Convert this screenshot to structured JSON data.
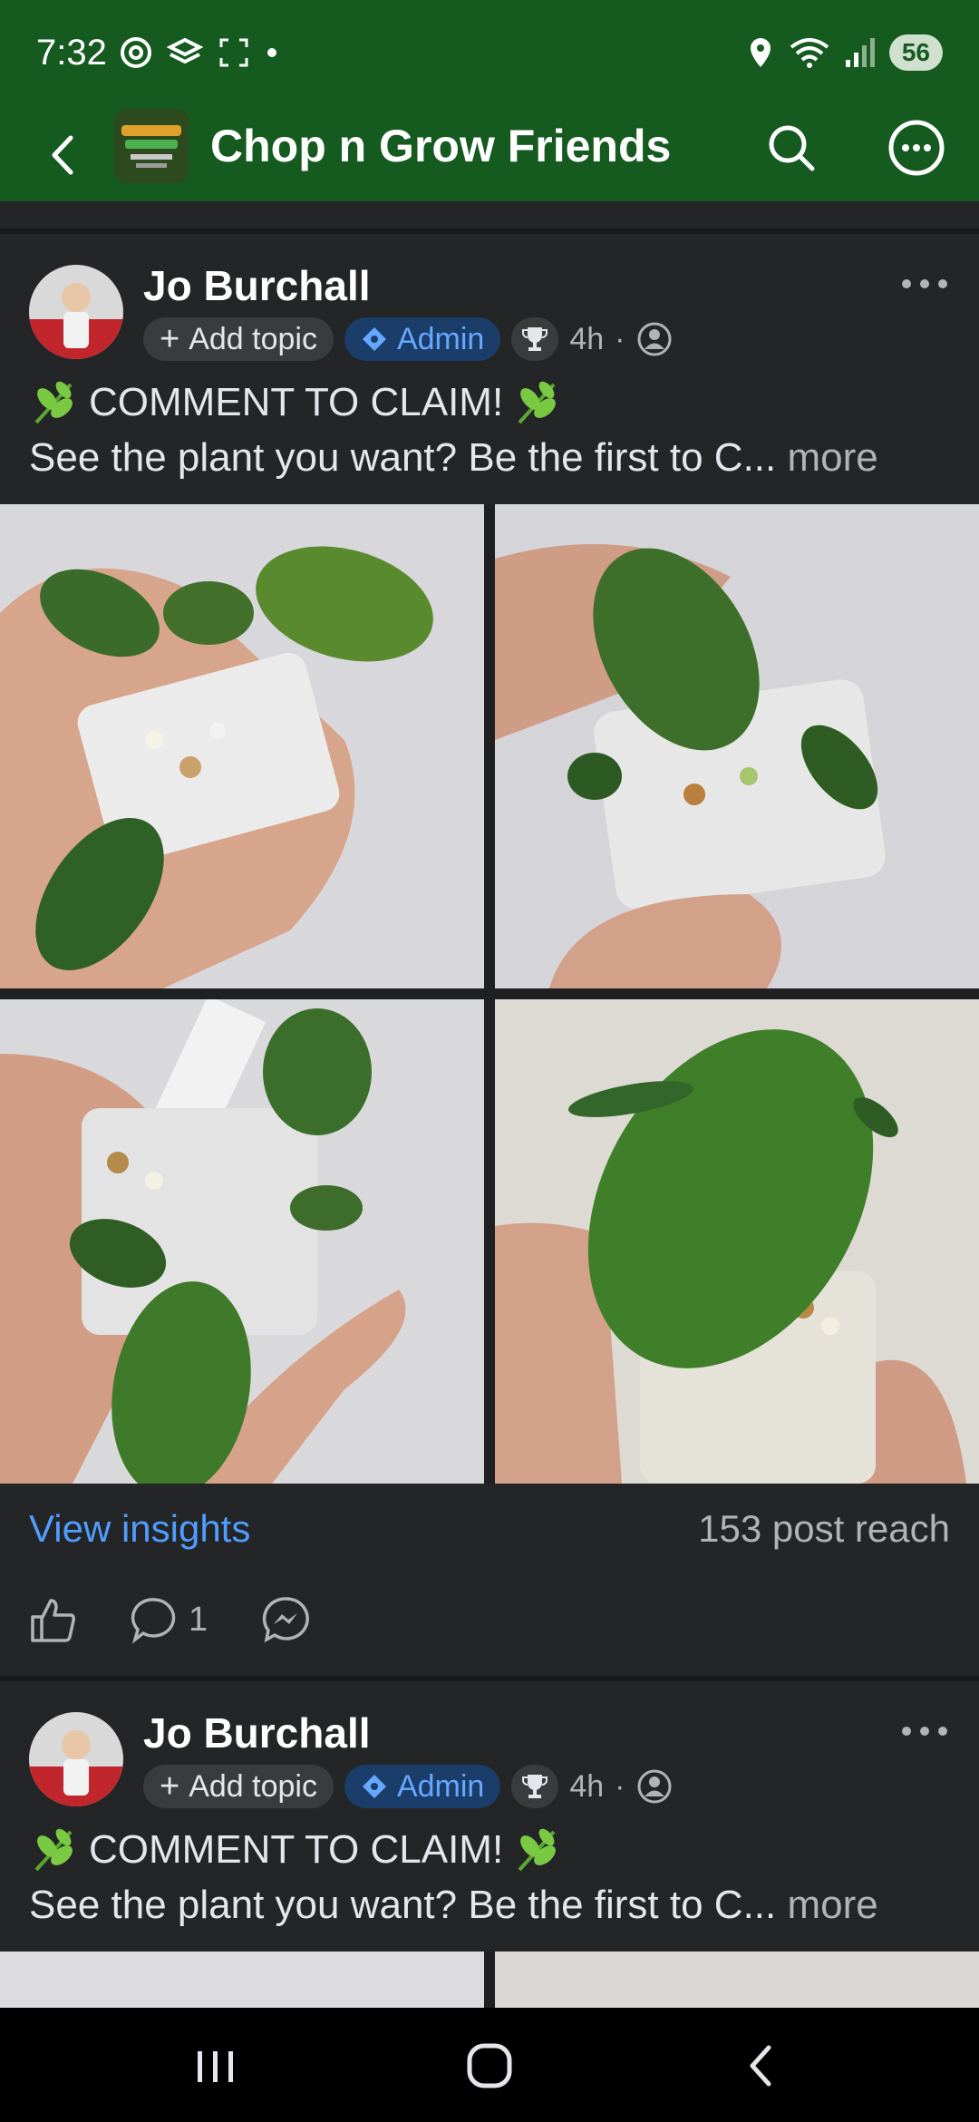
{
  "status_bar": {
    "time": "7:32",
    "battery": "56",
    "icons_left": [
      "threads-icon",
      "stack-icon",
      "screenshot-icon",
      "dot-icon"
    ],
    "icons_right": [
      "location-icon",
      "wifi-icon",
      "signal-icon",
      "battery-icon"
    ]
  },
  "app_bar": {
    "title": "Chop n Grow Friends",
    "icons": [
      "back-arrow-icon",
      "search-icon",
      "more-circle-icon"
    ],
    "accent_color": "#155a1f"
  },
  "posts": [
    {
      "author": "Jo Burchall",
      "add_topic": "Add topic",
      "admin_badge": "Admin",
      "time": "4h",
      "separator": "·",
      "line1": "COMMENT TO CLAIM!",
      "line2": "See the plant you want? Be the first to C...",
      "more": "more",
      "insights": "View insights",
      "reach": "153 post reach",
      "comment_count": "1"
    },
    {
      "author": "Jo Burchall",
      "add_topic": "Add topic",
      "admin_badge": "Admin",
      "time": "4h",
      "separator": "·",
      "line1": "COMMENT TO CLAIM!",
      "line2": "See the plant you want? Be the first to C...",
      "more": "more"
    }
  ],
  "colors": {
    "background": "#242526",
    "link": "#4f9dff",
    "admin_badge_bg": "#1b3d6a"
  }
}
